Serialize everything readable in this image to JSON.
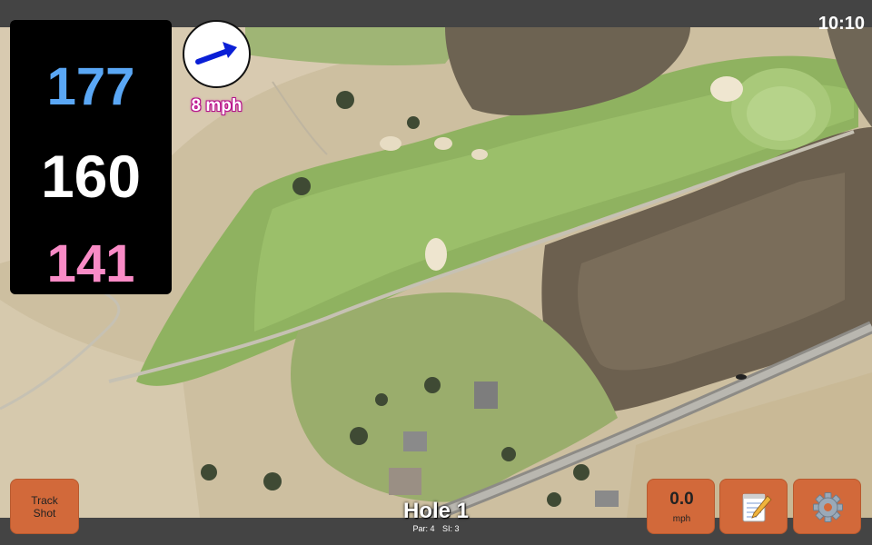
{
  "status": {
    "time": "10:10"
  },
  "distances": {
    "back": "177",
    "middle": "160",
    "front": "141"
  },
  "wind": {
    "speed_label": "8 mph",
    "direction_icon": "wind-arrow-icon"
  },
  "hole": {
    "title": "Hole 1",
    "par_label": "Par: 4",
    "si_label": "SI: 3"
  },
  "buttons": {
    "track_shot_line1": "Track",
    "track_shot_line2": "Shot",
    "speed_value": "0.0",
    "speed_unit": "mph",
    "notes_icon": "notepad-icon",
    "settings_icon": "gear-icon"
  },
  "colors": {
    "back_distance": "#5aa7f5",
    "middle_distance": "#ffffff",
    "front_distance": "#f98bc6",
    "button_accent": "#d2693a",
    "wind_arrow": "#0a1fd6",
    "wind_text_glow": "#c8179a"
  }
}
